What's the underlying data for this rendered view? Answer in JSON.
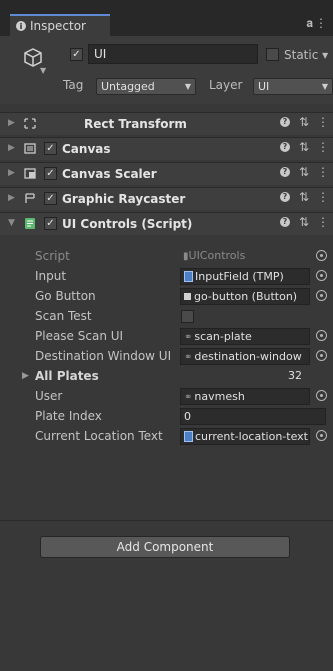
{
  "tab": {
    "title": "Inspector"
  },
  "object": {
    "name": "UI",
    "active": true,
    "static_label": "Static",
    "tag_label": "Tag",
    "tag_value": "Untagged",
    "layer_label": "Layer",
    "layer_value": "UI"
  },
  "components": [
    {
      "title": "Rect Transform",
      "has_checkbox": false,
      "icon": "rect-transform-icon"
    },
    {
      "title": "Canvas",
      "has_checkbox": true,
      "icon": "canvas-icon"
    },
    {
      "title": "Canvas Scaler",
      "has_checkbox": true,
      "icon": "canvas-scaler-icon"
    },
    {
      "title": "Graphic Raycaster",
      "has_checkbox": true,
      "icon": "graphic-raycaster-icon"
    },
    {
      "title": "UI Controls (Script)",
      "has_checkbox": true,
      "icon": "script-icon"
    }
  ],
  "properties": [
    {
      "label": "Script",
      "value": "UIControls"
    },
    {
      "label": "Input",
      "value": "InputField (TMP)"
    },
    {
      "label": "Go Button",
      "value": "go-button (Button)"
    },
    {
      "label": "Scan Test",
      "value": ""
    },
    {
      "label": "Please Scan UI",
      "value": "scan-plate"
    },
    {
      "label": "Destination Window UI",
      "value": "destination-window"
    },
    {
      "label": "All Plates",
      "value": "32"
    },
    {
      "label": "User",
      "value": "navmesh"
    },
    {
      "label": "Plate Index",
      "value": "0"
    },
    {
      "label": "Current Location Text",
      "value": "current-location-text"
    }
  ],
  "add_component_label": "Add Component",
  "colors": {
    "background": "#383838",
    "tab_accent": "#5e8ad6",
    "field": "#2c2c2c"
  }
}
